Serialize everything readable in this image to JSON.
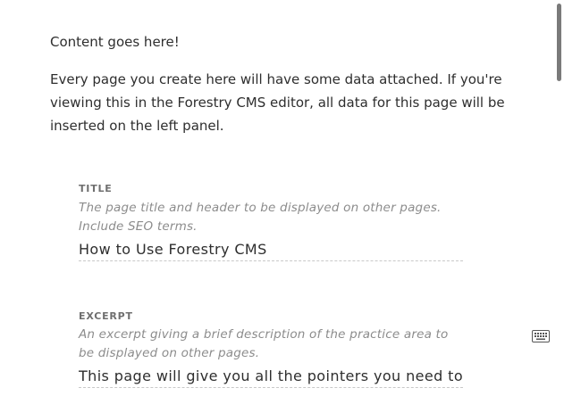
{
  "content": {
    "paragraphs": [
      "Content goes here!",
      "Every page you create here will have some data attached. If you're viewing this in the Forestry CMS editor, all data for this page will be inserted on the left panel."
    ]
  },
  "fields": [
    {
      "label": "TITLE",
      "help": "The page title and header to be displayed on other pages. Include SEO terms.",
      "value": "How to Use Forestry CMS"
    },
    {
      "label": "EXCERPT",
      "help": "An excerpt giving a brief description of the practice area to be displayed on other pages.",
      "value": "This page will give you all the pointers you need to g"
    }
  ],
  "icons": {
    "keyboard": "keyboard-icon"
  }
}
